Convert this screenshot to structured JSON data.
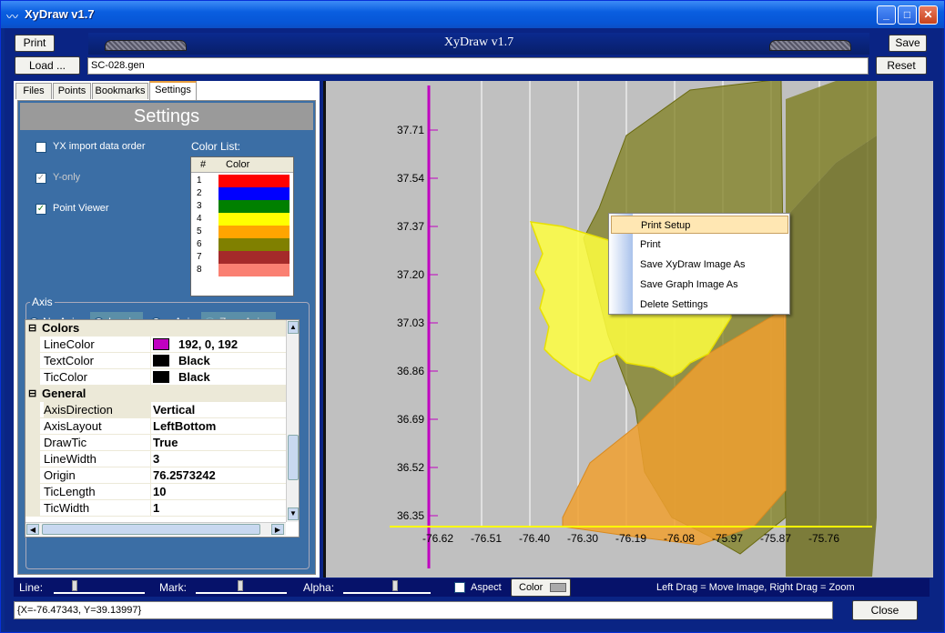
{
  "window": {
    "title": "XyDraw v1.7",
    "banner": "XyDraw v1.7"
  },
  "toolbar": {
    "print": "Print",
    "load": "Load ...",
    "file": "SC-028.gen",
    "save": "Save",
    "reset": "Reset"
  },
  "tabs": [
    "Files",
    "Points",
    "Bookmarks",
    "Settings"
  ],
  "settings": {
    "header": "Settings",
    "yx_import": "YX import data order",
    "y_only": "Y-only",
    "point_viewer": "Point Viewer",
    "color_list_label": "Color List:",
    "color_list_col_num": "#",
    "color_list_col_color": "Color",
    "colors": [
      {
        "n": "1",
        "hex": "#ff0000"
      },
      {
        "n": "2",
        "hex": "#0000ff"
      },
      {
        "n": "3",
        "hex": "#008000"
      },
      {
        "n": "4",
        "hex": "#ffff00"
      },
      {
        "n": "5",
        "hex": "#ffa500"
      },
      {
        "n": "6",
        "hex": "#808000"
      },
      {
        "n": "7",
        "hex": "#a52a2a"
      },
      {
        "n": "8",
        "hex": "#fa8072"
      }
    ],
    "axis_label": "Axis",
    "axis_opts": [
      "No Axis",
      "L axis",
      "+ Axis",
      "Zero Axis"
    ]
  },
  "props": {
    "cat_colors": "Colors",
    "cat_general": "General",
    "rows_colors": [
      {
        "name": "LineColor",
        "value": "192, 0, 192",
        "swatch": "#c000c0"
      },
      {
        "name": "TextColor",
        "value": "Black",
        "swatch": "#000000"
      },
      {
        "name": "TicColor",
        "value": "Black",
        "swatch": "#000000"
      }
    ],
    "rows_general": [
      {
        "name": "AxisDirection",
        "value": "Vertical"
      },
      {
        "name": "AxisLayout",
        "value": "LeftBottom"
      },
      {
        "name": "DrawTic",
        "value": "True"
      },
      {
        "name": "LineWidth",
        "value": "3"
      },
      {
        "name": "Origin",
        "value": "76.2573242"
      },
      {
        "name": "TicLength",
        "value": "10"
      },
      {
        "name": "TicWidth",
        "value": "1"
      }
    ]
  },
  "chart_data": {
    "type": "area",
    "yticks": [
      "37.71",
      "37.54",
      "37.37",
      "37.20",
      "37.03",
      "36.86",
      "36.69",
      "36.52",
      "36.35"
    ],
    "xticks": [
      "-76.62",
      "-76.51",
      "-76.40",
      "-76.30",
      "-76.19",
      "-76.08",
      "-75.97",
      "-75.87",
      "-75.76"
    ],
    "y_axis_color": "#c000c0",
    "x_axis_color": "#ffff00",
    "polygon_colors": [
      "#ffff40",
      "#f0a030",
      "#808020"
    ]
  },
  "context_menu": [
    "Print Setup",
    "Print",
    "Save  XyDraw Image As",
    "Save Graph Image As",
    "Delete Settings"
  ],
  "bottom": {
    "line": "Line:",
    "mark": "Mark:",
    "alpha": "Alpha:",
    "aspect": "Aspect",
    "color": "Color",
    "hint": "Left Drag = Move Image,   Right Drag = Zoom",
    "status": "{X=-76.47343, Y=39.13997}",
    "close": "Close"
  }
}
